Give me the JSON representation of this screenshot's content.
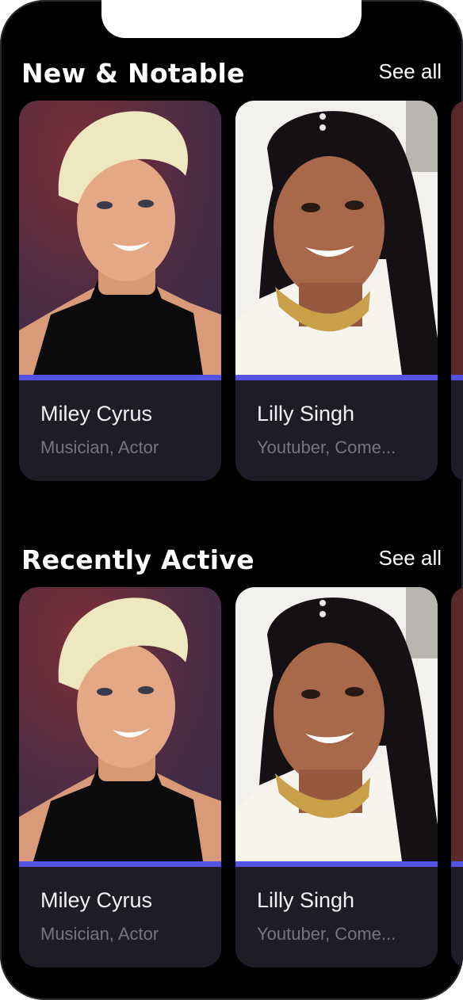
{
  "theme": {
    "background": "#000000",
    "card_bg": "#1f1c28",
    "accent": "#5552e6",
    "muted_text": "#77737f"
  },
  "sections": [
    {
      "title": "New & Notable",
      "see_all": "See all",
      "cards": [
        {
          "name": "Miley Cyrus",
          "role": "Musician, Actor"
        },
        {
          "name": "Lilly Singh",
          "role": "Youtuber, Come..."
        }
      ]
    },
    {
      "title": "Recently Active",
      "see_all": "See all",
      "cards": [
        {
          "name": "Miley Cyrus",
          "role": "Musician, Actor"
        },
        {
          "name": "Lilly Singh",
          "role": "Youtuber, Come..."
        }
      ]
    }
  ]
}
